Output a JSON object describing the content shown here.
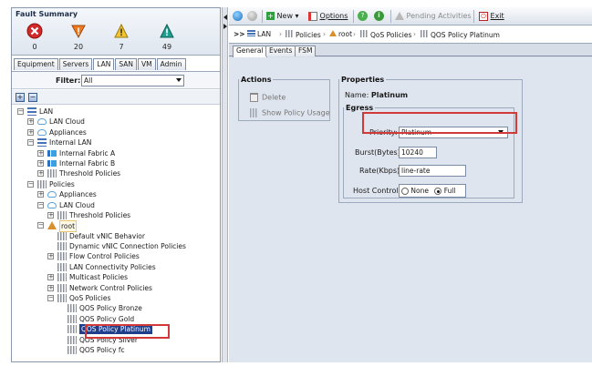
{
  "fault_summary": {
    "title": "Fault Summary",
    "critical": "0",
    "major": "20",
    "minor": "7",
    "warning": "49"
  },
  "nav_tabs": [
    "Equipment",
    "Servers",
    "LAN",
    "SAN",
    "VM",
    "Admin"
  ],
  "filter": {
    "label": "Filter:",
    "value": "All"
  },
  "tree": [
    {
      "label": "LAN",
      "icon": "lan-icon",
      "level": 0,
      "toggle": "-"
    },
    {
      "label": "LAN Cloud",
      "icon": "cloud-icon",
      "level": 1,
      "toggle": "+"
    },
    {
      "label": "Appliances",
      "icon": "cloud-icon",
      "level": 1,
      "toggle": "+"
    },
    {
      "label": "Internal LAN",
      "icon": "lan-icon",
      "level": 1,
      "toggle": "-"
    },
    {
      "label": "Internal Fabric A",
      "icon": "fabric-icon",
      "level": 2,
      "toggle": "+"
    },
    {
      "label": "Internal Fabric B",
      "icon": "fabric-icon",
      "level": 2,
      "toggle": "+"
    },
    {
      "label": "Threshold Policies",
      "icon": "policy-icon",
      "level": 2,
      "toggle": "+"
    },
    {
      "label": "Policies",
      "icon": "policy-icon",
      "level": 1,
      "toggle": "-"
    },
    {
      "label": "Appliances",
      "icon": "cloud-icon",
      "level": 2,
      "toggle": "+"
    },
    {
      "label": "LAN Cloud",
      "icon": "cloud-icon",
      "level": 2,
      "toggle": "-"
    },
    {
      "label": "Threshold Policies",
      "icon": "policy-icon",
      "level": 3,
      "toggle": "+"
    },
    {
      "label": "root",
      "icon": "root-icon",
      "level": 2,
      "toggle": "-"
    },
    {
      "label": "Default vNIC Behavior",
      "icon": "policy-icon",
      "level": 3,
      "toggle": ""
    },
    {
      "label": "Dynamic vNIC Connection Policies",
      "icon": "policy-icon",
      "level": 3,
      "toggle": ""
    },
    {
      "label": "Flow Control Policies",
      "icon": "policy-icon",
      "level": 3,
      "toggle": "+"
    },
    {
      "label": "LAN Connectivity Policies",
      "icon": "policy-icon",
      "level": 3,
      "toggle": ""
    },
    {
      "label": "Multicast Policies",
      "icon": "policy-icon",
      "level": 3,
      "toggle": "+"
    },
    {
      "label": "Network Control Policies",
      "icon": "policy-icon",
      "level": 3,
      "toggle": "+"
    },
    {
      "label": "QoS Policies",
      "icon": "policy-icon",
      "level": 3,
      "toggle": "-"
    },
    {
      "label": "QOS Policy Bronze",
      "icon": "policy-icon",
      "level": 4,
      "toggle": ""
    },
    {
      "label": "QOS Policy Gold",
      "icon": "policy-icon",
      "level": 4,
      "toggle": ""
    },
    {
      "label": "QOS Policy Platinum",
      "icon": "policy-icon",
      "level": 4,
      "toggle": "",
      "selected": true
    },
    {
      "label": "QOS Policy Silver",
      "icon": "policy-icon",
      "level": 4,
      "toggle": ""
    },
    {
      "label": "QOS Policy fc",
      "icon": "policy-icon",
      "level": 4,
      "toggle": ""
    }
  ],
  "toolbar": {
    "new_label": "New",
    "options_label": "Options",
    "pending_label": "Pending Activities",
    "exit_label": "Exit"
  },
  "breadcrumb": {
    "prefix": ">>",
    "items": [
      "LAN",
      "Policies",
      "root",
      "QoS Policies",
      "QOS Policy Platinum"
    ]
  },
  "tabs": [
    "General",
    "Events",
    "FSM"
  ],
  "actions": {
    "title": "Actions",
    "delete": "Delete",
    "show_policy_usage": "Show Policy Usage"
  },
  "properties": {
    "title": "Properties",
    "name_label": "Name:",
    "name_value": "Platinum",
    "egress_title": "Egress",
    "priority_label": "Priority:",
    "priority_value": "Platinum",
    "burst_label": "Burst(Bytes):",
    "burst_value": "10240",
    "rate_label": "Rate(Kbps):",
    "rate_value": "line-rate",
    "host_control_label": "Host Control:",
    "host_none": "None",
    "host_full": "Full"
  },
  "colors": {
    "highlight_box": "#d23a3a",
    "selection": "#1f3f8c"
  }
}
